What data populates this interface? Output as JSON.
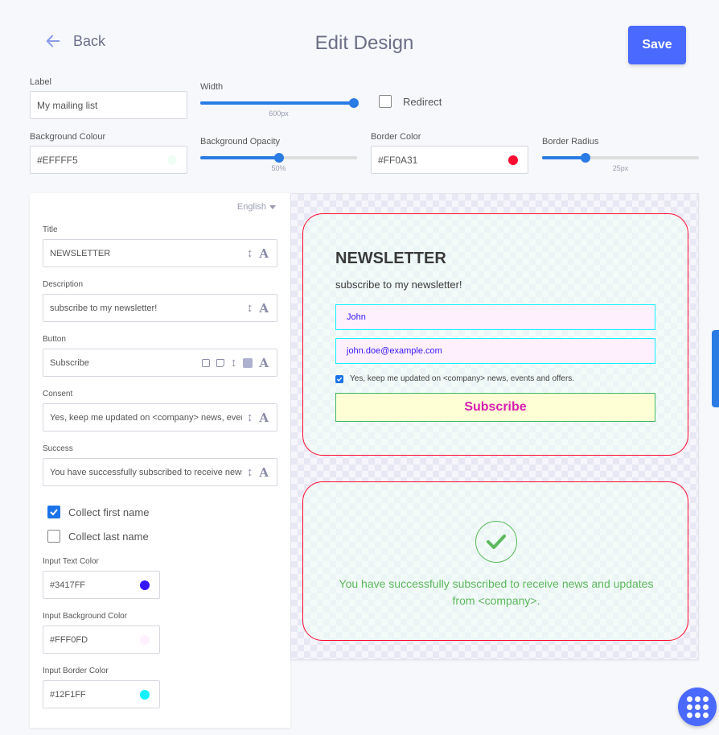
{
  "header": {
    "back_label": "Back",
    "title": "Edit Design",
    "save_label": "Save"
  },
  "controls": {
    "label": {
      "label": "Label",
      "value": "My mailing list"
    },
    "width": {
      "label": "Width",
      "value_text": "600px",
      "fraction": 1.0
    },
    "redirect": {
      "label": "Redirect",
      "checked": false
    },
    "background_colour": {
      "label": "Background Colour",
      "value": "#EFFFF5",
      "color": "#EFFFF5"
    },
    "background_opacity": {
      "label": "Background Opacity",
      "value_text": "50%",
      "fraction": 0.5
    },
    "border_color": {
      "label": "Border Color",
      "value": "#FF0A31",
      "color": "#FF0A31"
    },
    "border_radius": {
      "label": "Border Radius",
      "value_text": "25px",
      "fraction": 0.27
    }
  },
  "panel": {
    "language": "English",
    "title": {
      "label": "Title",
      "value": "NEWSLETTER"
    },
    "description": {
      "label": "Description",
      "value": "subscribe to my newsletter!"
    },
    "button": {
      "label": "Button",
      "value": "Subscribe"
    },
    "consent": {
      "label": "Consent",
      "value": "Yes, keep me updated on <company> news, events and offers."
    },
    "success": {
      "label": "Success",
      "value": "You have successfully subscribed to receive news and updates from <company>."
    },
    "collect_first_name": {
      "label": "Collect first name",
      "checked": true
    },
    "collect_last_name": {
      "label": "Collect last name",
      "checked": false
    },
    "input_text_color": {
      "label": "Input Text Color",
      "value": "#3417FF",
      "color": "#3417FF"
    },
    "input_background_color": {
      "label": "Input Background Color",
      "value": "#FFF0FD",
      "color": "#FFF0FD"
    },
    "input_border_color": {
      "label": "Input Border Color",
      "value": "#12F1FF",
      "color": "#12F1FF"
    }
  },
  "preview": {
    "title": "NEWSLETTER",
    "description": "subscribe to my newsletter!",
    "name_value": "John",
    "email_value": "john.doe@example.com",
    "consent": "Yes, keep me updated on <company> news, events and offers.",
    "button": "Subscribe",
    "success_message": "You have successfully subscribed to receive news and updates from <company>."
  },
  "colors": {
    "accent": "#4A69FF",
    "slider": "#2A7BE4",
    "success": "#5CB85C",
    "button_text": "#D61FB0",
    "button_bg": "#FFFFD6",
    "button_border": "#3FB965"
  }
}
